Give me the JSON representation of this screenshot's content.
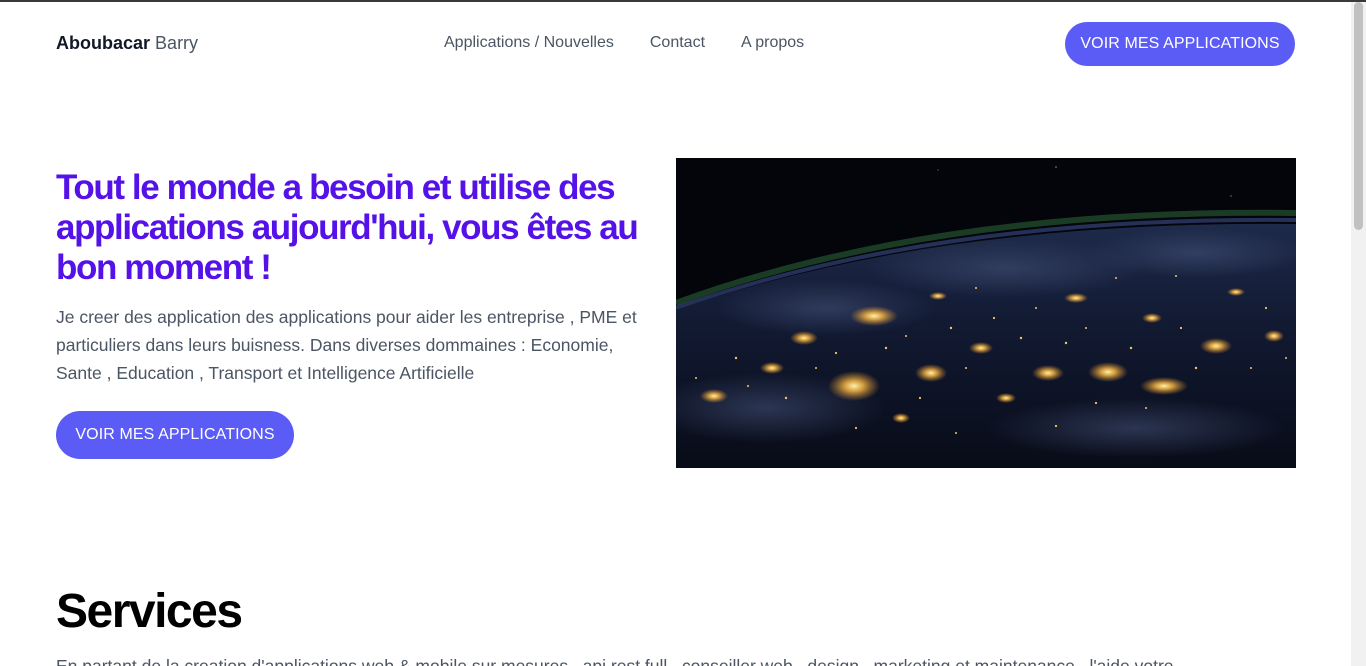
{
  "nav": {
    "brand_first": "Aboubacar",
    "brand_last": "Barry",
    "links": [
      "Applications / Nouvelles",
      "Contact",
      "A propos"
    ],
    "cta_label": "VOIR MES APPLICATIONS"
  },
  "hero": {
    "title": "Tout le monde a besoin et utilise des applications aujourd'hui, vous êtes au bon moment !",
    "text": "Je creer des application des applications pour aider les entreprise , PME et particuliers dans leurs buisness. Dans diverses dommaines : Economie, Sante , Education , Transport et Intelligence Artificielle",
    "cta_label": "VOIR MES APPLICATIONS",
    "image": "earth-at-night-from-space-image"
  },
  "services": {
    "title": "Services",
    "text": "En partant de la creation d'applications web & mobile sur mesures , api rest full , conseiller web , design , marketing et maintenance , l'aide votre"
  },
  "colors": {
    "accent_button": "#5b5bf5",
    "hero_title": "#5512e8",
    "body_text": "#4b5563"
  }
}
